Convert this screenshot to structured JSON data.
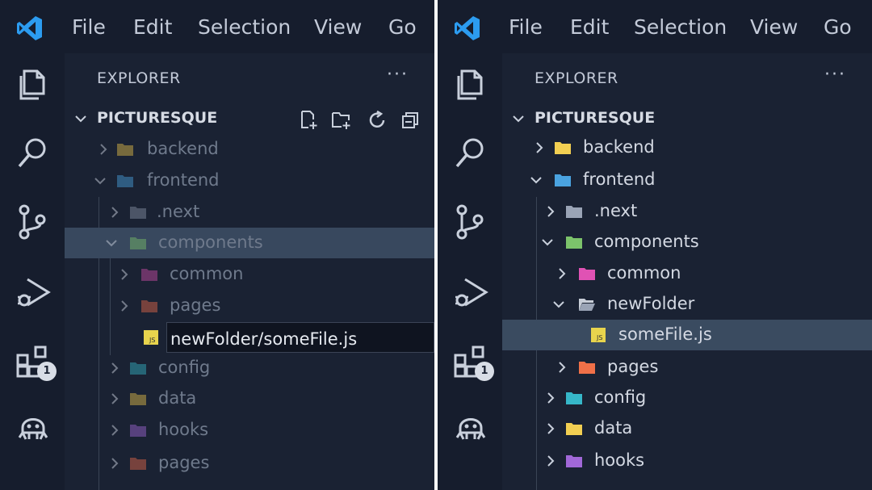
{
  "menu": [
    "File",
    "Edit",
    "Selection",
    "View",
    "Go"
  ],
  "explorer_title": "EXPLORER",
  "more": "···",
  "project": "PICTURESQUE",
  "badge": "1",
  "left": {
    "rows": [
      {
        "label": "backend",
        "icon": "folder-yellow",
        "color": "#e8c24a"
      },
      {
        "label": "frontend",
        "icon": "folder-blue",
        "color": "#4aa3e0"
      },
      {
        "label": ".next",
        "icon": "folder-gray",
        "color": "#8a94a6"
      },
      {
        "label": "components",
        "icon": "folder-green",
        "color": "#7cc36b"
      },
      {
        "label": "common",
        "icon": "folder-pink",
        "color": "#d04ea8"
      },
      {
        "label": "pages",
        "icon": "folder-orange",
        "color": "#e86a4a"
      },
      {
        "label": "newFolder/someFile.js",
        "icon": "js-file",
        "color": "#e8d44d"
      },
      {
        "label": "config",
        "icon": "folder-teal",
        "color": "#36b7c9"
      },
      {
        "label": "data",
        "icon": "folder-yellow",
        "color": "#e8c24a"
      },
      {
        "label": "hooks",
        "icon": "folder-purple",
        "color": "#a168d8"
      },
      {
        "label": "pages",
        "icon": "folder-orange",
        "color": "#e86a4a"
      }
    ]
  },
  "right": {
    "rows": [
      {
        "label": "backend",
        "icon": "folder-yellow",
        "color": "#f2cf52"
      },
      {
        "label": "frontend",
        "icon": "folder-blue",
        "color": "#4aa3e0"
      },
      {
        "label": ".next",
        "icon": "folder-gray",
        "color": "#9aa4b6"
      },
      {
        "label": "components",
        "icon": "folder-green",
        "color": "#7cc36b"
      },
      {
        "label": "common",
        "icon": "folder-pink",
        "color": "#e052b4"
      },
      {
        "label": "newFolder",
        "icon": "folder-open-gray",
        "color": "#c8ced8"
      },
      {
        "label": "someFile.js",
        "icon": "js-file",
        "color": "#e8d44d"
      },
      {
        "label": "pages",
        "icon": "folder-orange",
        "color": "#f07048"
      },
      {
        "label": "config",
        "icon": "folder-teal",
        "color": "#36b7c9"
      },
      {
        "label": "data",
        "icon": "folder-yellow",
        "color": "#f2cf52"
      },
      {
        "label": "hooks",
        "icon": "folder-purple",
        "color": "#a168d8"
      }
    ]
  }
}
